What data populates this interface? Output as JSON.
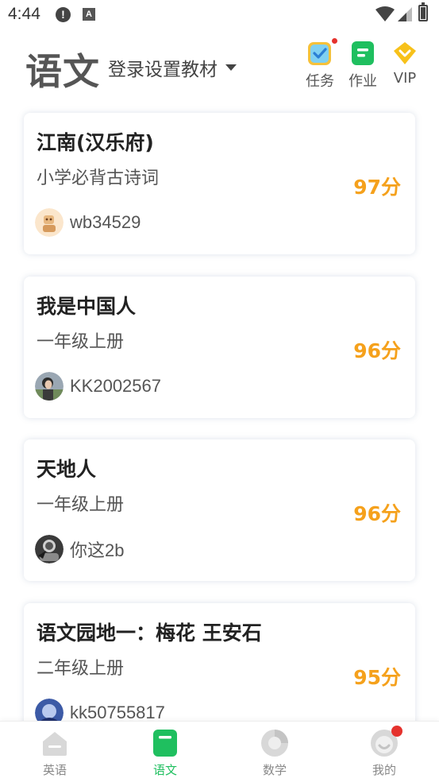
{
  "status_bar": {
    "time": "4:44",
    "alert_icon": "alert-circle-icon",
    "app_icon_letter": "A"
  },
  "header": {
    "subject": "语文",
    "textbook_selector": "登录设置教材",
    "task_label": "任务",
    "homework_label": "作业",
    "vip_label": "VIP"
  },
  "colors": {
    "accent_green": "#1fbf5f",
    "score_orange": "#f5a11c",
    "badge_red": "#e5322d",
    "vip_yellow": "#f7c11a"
  },
  "cards": [
    {
      "title": "江南(汉乐府)",
      "subtitle": "小学必背古诗词",
      "score": "97分",
      "username": "wb34529"
    },
    {
      "title": "我是中国人",
      "subtitle": "一年级上册",
      "score": "96分",
      "username": "KK2002567"
    },
    {
      "title": "天地人",
      "subtitle": "一年级上册",
      "score": "96分",
      "username": "你这2b"
    },
    {
      "title": "语文园地一：梅花 王安石",
      "subtitle": "二年级上册",
      "score": "95分",
      "username": "kk50755817"
    }
  ],
  "bottom_nav": {
    "english": "英语",
    "chinese": "语文",
    "math": "数学",
    "mine": "我的",
    "active": "chinese"
  }
}
